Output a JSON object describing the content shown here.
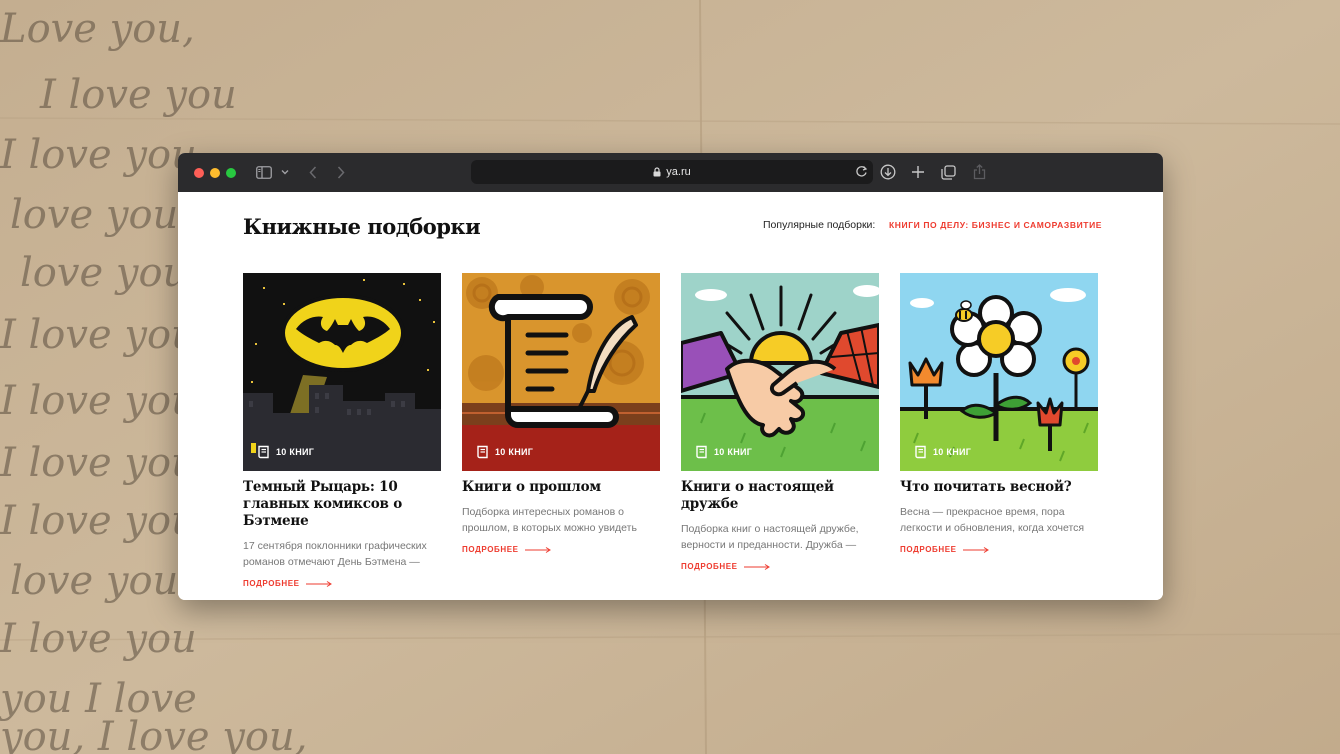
{
  "background": {
    "handwriting": [
      "Love you,",
      "I love you",
      "I love you,",
      "love you",
      "love you",
      "I love you",
      "I love you",
      "I love you",
      "I love you",
      "love you",
      "I love you",
      "you I love",
      "you, I love you,"
    ]
  },
  "browser": {
    "url": "ya.ru"
  },
  "page": {
    "title": "Книжные подборки",
    "popular_label": "Популярные подборки:",
    "popular_link": "КНИГИ ПО ДЕЛУ: БИЗНЕС И САМОРАЗВИТИЕ"
  },
  "cards": [
    {
      "badge": "10 КНИГ",
      "title": "Темный Рыцарь: 10 главных комиксов о Бэтмене",
      "desc": "17 сентября поклонники графических романов отмечают День Бэтмена —",
      "more": "ПОДРОБНЕЕ"
    },
    {
      "badge": "10 КНИГ",
      "title": "Книги о прошлом",
      "desc": "Подборка интересных романов о прошлом, в которых можно увидеть",
      "more": "ПОДРОБНЕЕ"
    },
    {
      "badge": "10 КНИГ",
      "title": "Книги о настоящей дружбе",
      "desc": "Подборка книг о настоящей дружбе, верности и преданности. Дружба —",
      "more": "ПОДРОБНЕЕ"
    },
    {
      "badge": "10 КНИГ",
      "title": "Что почитать весной?",
      "desc": "Весна — прекрасное время, пора легкости и обновления, когда хочется",
      "more": "ПОДРОБНЕЕ"
    }
  ],
  "colors": {
    "accent": "#ee3b2f",
    "paper": "#c9b497",
    "toolbar": "#2b2b2d"
  }
}
